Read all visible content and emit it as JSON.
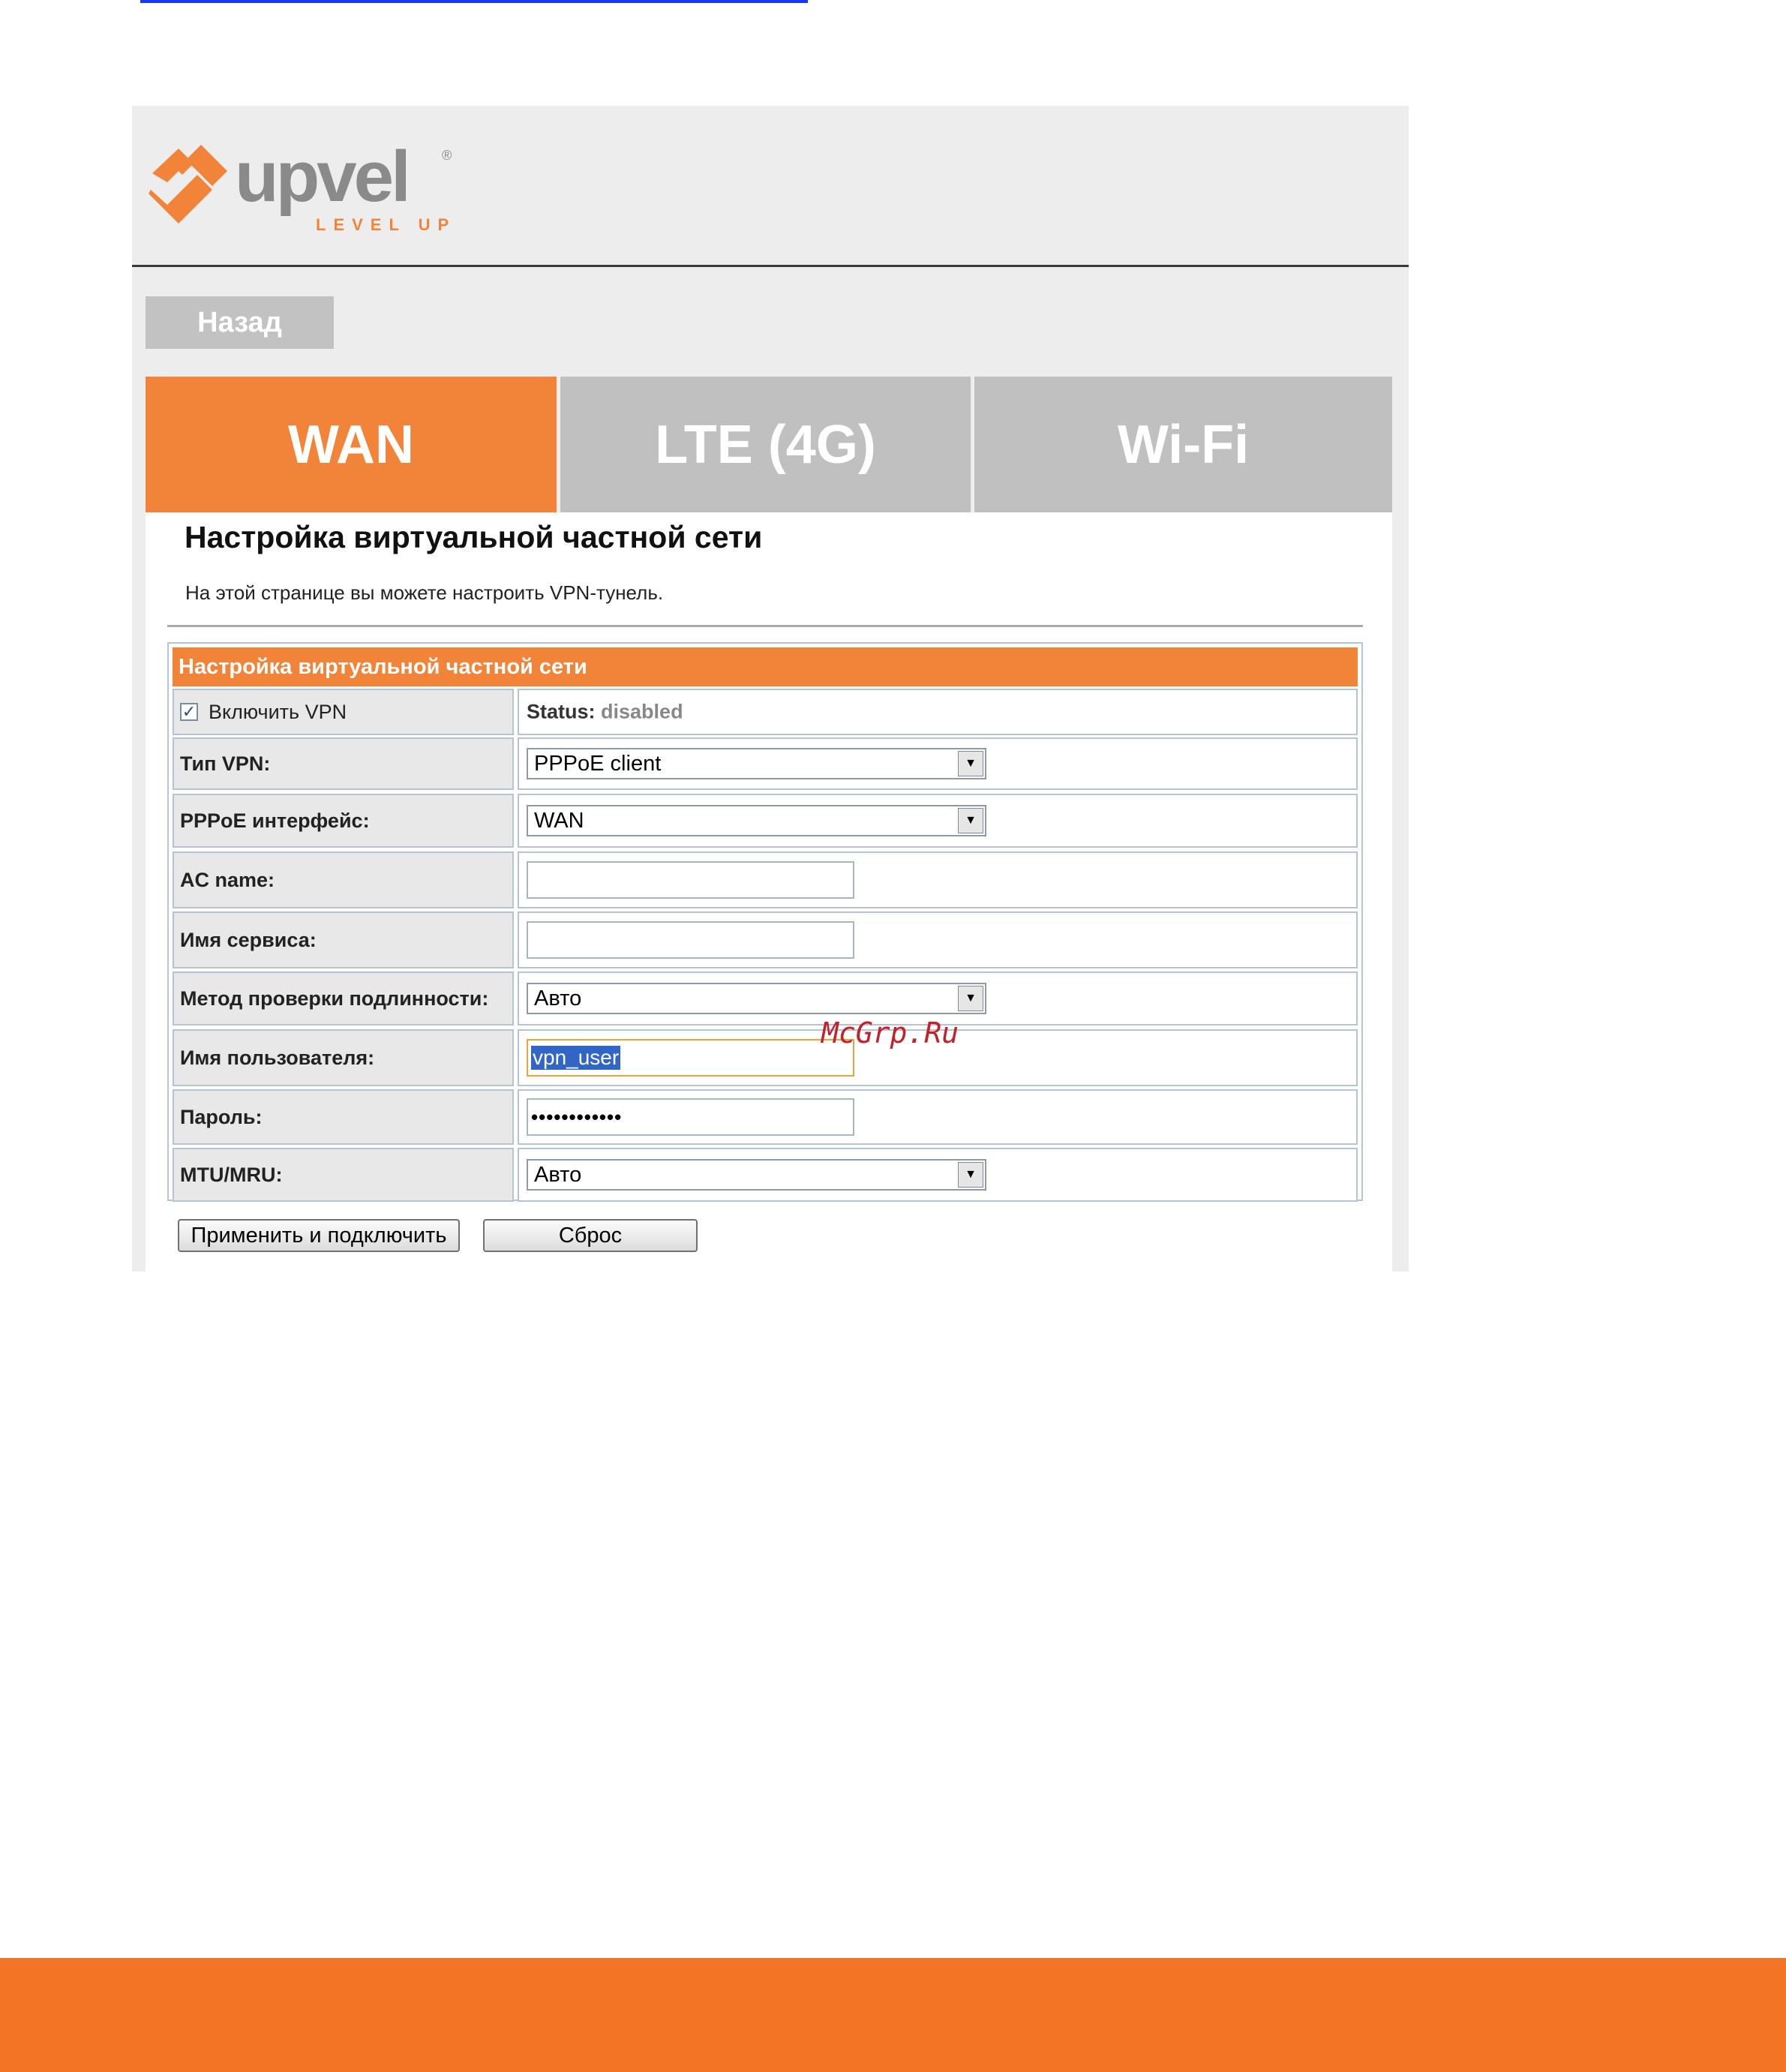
{
  "brand": {
    "name": "upvel",
    "tagline": "LEVEL UP",
    "registered": "®",
    "color": "#f2843a"
  },
  "nav": {
    "back_label": "Назад"
  },
  "tabs": [
    {
      "label": "WAN",
      "active": true
    },
    {
      "label": "LTE (4G)",
      "active": false
    },
    {
      "label": "Wi-Fi",
      "active": false
    }
  ],
  "page": {
    "title": "Настройка виртуальной частной сети",
    "description": "На этой странице вы можете настроить VPN-тунель."
  },
  "form": {
    "header": "Настройка виртуальной частной сети",
    "enable_vpn": {
      "label": "Включить VPN",
      "checked": true
    },
    "status": {
      "label": "Status:",
      "value": "disabled"
    },
    "vpn_type": {
      "label": "Тип VPN:",
      "value": "PPPoE client"
    },
    "pppoe_interface": {
      "label": "PPPoE интерфейс:",
      "value": "WAN"
    },
    "ac_name": {
      "label": "AC name:",
      "value": ""
    },
    "service_name": {
      "label": "Имя сервиса:",
      "value": ""
    },
    "auth_method": {
      "label": "Метод проверки подлинности:",
      "value": "Авто"
    },
    "username": {
      "label": "Имя пользователя:",
      "value": "vpn_user"
    },
    "password": {
      "label": "Пароль:",
      "masked": "••••••••••••"
    },
    "mtu_mru": {
      "label": "MTU/MRU:",
      "value": "Авто"
    }
  },
  "buttons": {
    "apply_label": "Применить и подключить",
    "reset_label": "Сброс"
  },
  "watermark": "McGrp.Ru"
}
